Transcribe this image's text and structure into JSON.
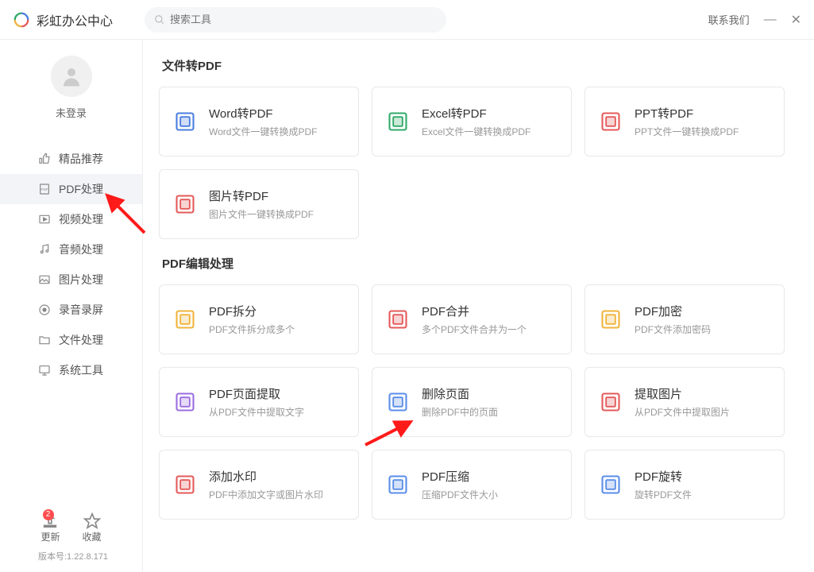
{
  "app": {
    "title": "彩虹办公中心"
  },
  "search": {
    "placeholder": "搜索工具"
  },
  "titlebar": {
    "contact": "联系我们"
  },
  "user": {
    "status": "未登录"
  },
  "nav": [
    {
      "id": "recommend",
      "label": "精品推荐",
      "icon": "thumb"
    },
    {
      "id": "pdf",
      "label": "PDF处理",
      "icon": "pdf",
      "active": true
    },
    {
      "id": "video",
      "label": "视频处理",
      "icon": "video"
    },
    {
      "id": "audio",
      "label": "音频处理",
      "icon": "audio"
    },
    {
      "id": "image",
      "label": "图片处理",
      "icon": "image"
    },
    {
      "id": "record",
      "label": "录音录屏",
      "icon": "record"
    },
    {
      "id": "file",
      "label": "文件处理",
      "icon": "file"
    },
    {
      "id": "system",
      "label": "系统工具",
      "icon": "system"
    }
  ],
  "bottom": {
    "update": {
      "label": "更新",
      "badge": "2"
    },
    "fav": {
      "label": "收藏"
    },
    "version": "版本号:1.22.8.171"
  },
  "sections": [
    {
      "title": "文件转PDF",
      "cards": [
        {
          "id": "word2pdf",
          "title": "Word转PDF",
          "desc": "Word文件一键转换成PDF",
          "color": "#4a7de0"
        },
        {
          "id": "excel2pdf",
          "title": "Excel转PDF",
          "desc": "Excel文件一键转换成PDF",
          "color": "#2fa968"
        },
        {
          "id": "ppt2pdf",
          "title": "PPT转PDF",
          "desc": "PPT文件一键转换成PDF",
          "color": "#e55959"
        },
        {
          "id": "img2pdf",
          "title": "图片转PDF",
          "desc": "图片文件一键转换成PDF",
          "color": "#e55959"
        }
      ]
    },
    {
      "title": "PDF编辑处理",
      "cards": [
        {
          "id": "split",
          "title": "PDF拆分",
          "desc": "PDF文件拆分成多个",
          "color": "#f0b43c"
        },
        {
          "id": "merge",
          "title": "PDF合并",
          "desc": "多个PDF文件合并为一个",
          "color": "#e55959"
        },
        {
          "id": "encrypt",
          "title": "PDF加密",
          "desc": "PDF文件添加密码",
          "color": "#f0b43c"
        },
        {
          "id": "extract-page",
          "title": "PDF页面提取",
          "desc": "从PDF文件中提取文字",
          "color": "#9b6de0"
        },
        {
          "id": "delete-page",
          "title": "删除页面",
          "desc": "删除PDF中的页面",
          "color": "#5a8de8"
        },
        {
          "id": "extract-img",
          "title": "提取图片",
          "desc": "从PDF文件中提取图片",
          "color": "#e55959"
        },
        {
          "id": "watermark",
          "title": "添加水印",
          "desc": "PDF中添加文字或图片水印",
          "color": "#e55959"
        },
        {
          "id": "compress",
          "title": "PDF压缩",
          "desc": "压缩PDF文件大小",
          "color": "#5a8de8"
        },
        {
          "id": "rotate",
          "title": "PDF旋转",
          "desc": "旋转PDF文件",
          "color": "#5a8de8"
        }
      ]
    }
  ]
}
